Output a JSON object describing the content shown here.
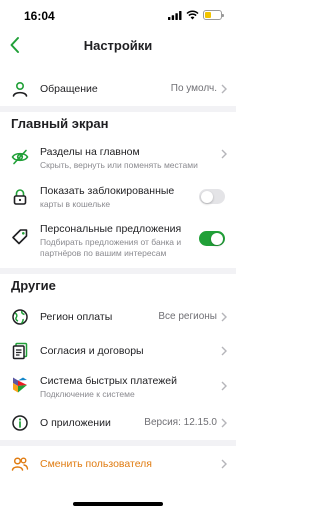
{
  "status_bar": {
    "time": "16:04",
    "battery_color": "#f2c400"
  },
  "nav": {
    "title": "Настройки",
    "back_icon": "chevron-left-icon"
  },
  "colors": {
    "accent_green": "#21a038",
    "orange": "#e07b10",
    "muted": "#8a8a8f"
  },
  "items": {
    "appeal": {
      "title": "Обращение",
      "value": "По умолч."
    },
    "sections": {
      "title": "Разделы на главном",
      "subtitle": "Скрыть, вернуть или поменять местами"
    },
    "blocked": {
      "title": "Показать заблокированные",
      "subtitle": "карты в кошельке",
      "toggle_on": false
    },
    "offers": {
      "title": "Персональные предложения",
      "subtitle1": "Подбирать предложения от банка и",
      "subtitle2": "партнёров по вашим интересам",
      "toggle_on": true
    },
    "region": {
      "title": "Регион оплаты",
      "value": "Все регионы"
    },
    "agreements": {
      "title": "Согласия и договоры"
    },
    "sbp": {
      "title": "Система быстрых платежей",
      "subtitle": "Подключение к системе"
    },
    "about": {
      "title": "О приложении",
      "value": "Версия: 12.15.0"
    },
    "switch_user": {
      "title": "Сменить пользователя"
    }
  },
  "section_headers": {
    "main_screen": "Главный экран",
    "other": "Другие"
  }
}
